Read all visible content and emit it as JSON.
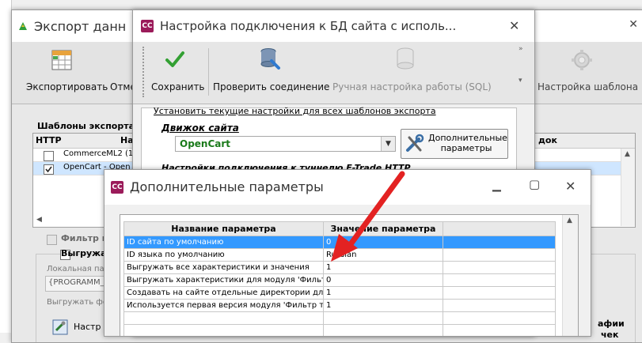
{
  "bg_window": {
    "title": "Экспорт данн",
    "toolbar": {
      "export_label": "Экспортировать",
      "partial_label": "Отме",
      "template_settings_label": "Настройка шаблона"
    },
    "templates_label": "Шаблоны экспорта:",
    "http_header": "HTTP",
    "name_header_partial": "На",
    "order_header_partial": "док",
    "templates": [
      {
        "label": "CommerceML2 (1",
        "checked": false
      },
      {
        "label": "OpenCart - Open",
        "checked": true
      }
    ],
    "filter_label": "Фильтр п",
    "unload_label": "Выгружа",
    "local_path_label": "Локальная па",
    "path_value": "{PROGRAMM_",
    "unload_fo_label": "Выгружать фо",
    "nastr_label": "Настр",
    "grafii_label_1": "афии",
    "grafii_label_2": "чек"
  },
  "conn_window": {
    "title": "Настройка подключения к БД сайта с исполь...",
    "icon_text": "CC",
    "toolbar": {
      "save_label": "Сохранить",
      "check_label": "Проверить соединение",
      "sql_label": "Ручная настройка работы (SQL)"
    },
    "apply_all_link": "Установить текущие настройки для всех шаблонов экспорта",
    "engine_label": "Движок сайта",
    "engine_value": "OpenCart",
    "extra_params_button": "Дополнительные параметры",
    "tunnel_label": "Настройки подключения к туннелю E-Trade HTTP"
  },
  "params_window": {
    "title": "Дополнительные параметры",
    "icon_text": "CC",
    "col_name": "Название параметра",
    "col_value": "Значение параметра",
    "rows": [
      {
        "name": "ID сайта по умолчанию",
        "value": "0",
        "selected": true
      },
      {
        "name": "ID языка по умолчанию",
        "value": "Russian",
        "selected": false
      },
      {
        "name": "Выгружать все характеристики и значения",
        "value": "1",
        "selected": false
      },
      {
        "name": "Выгружать характеристики для модуля 'Фильтр",
        "value": "0",
        "selected": false
      },
      {
        "name": "Создавать на сайте отдельные директории для",
        "value": "1",
        "selected": false
      },
      {
        "name": "Используется первая версия модуля 'Фильтр тов",
        "value": "1",
        "selected": false
      }
    ]
  },
  "colors": {
    "selection": "#3399ff",
    "arrow": "#e32222",
    "app_icon": "#9b1b5a",
    "engine_text": "#1a7a1a"
  },
  "icons": [
    "checkmark-icon",
    "connection-icon",
    "database-sql-icon",
    "gear-icon",
    "export-table-icon",
    "tools-icon",
    "scroll-arrow-icon"
  ]
}
